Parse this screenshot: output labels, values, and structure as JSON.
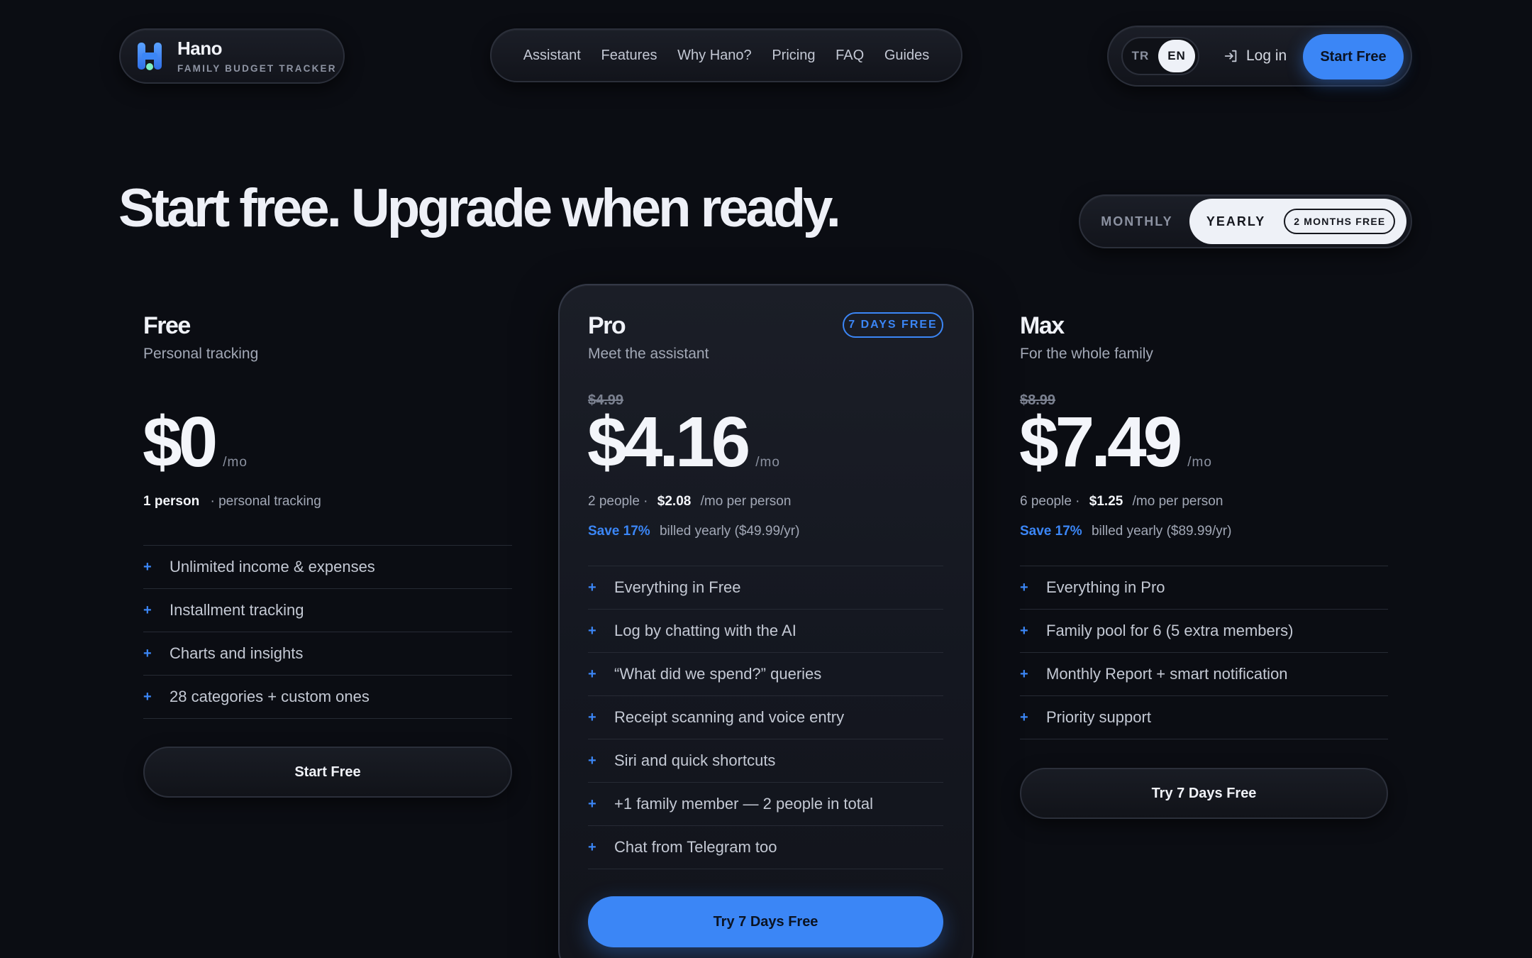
{
  "header": {
    "brand_name": "Hano",
    "brand_tagline": "FAMILY BUDGET TRACKER",
    "nav": [
      "Assistant",
      "Features",
      "Why Hano?",
      "Pricing",
      "FAQ",
      "Guides"
    ],
    "lang_tr": "TR",
    "lang_en": "EN",
    "login_label": "Log in",
    "cta_label": "Start Free"
  },
  "hero": {
    "title": "Start free. Upgrade when ready.",
    "billing": {
      "monthly_label": "MONTHLY",
      "yearly_label": "YEARLY",
      "yearly_badge": "2 MONTHS FREE",
      "selected": "yearly"
    }
  },
  "plans": [
    {
      "name": "Free",
      "subtitle": "Personal tracking",
      "price": "$0",
      "per": "/mo",
      "people_bold": "1 person",
      "people_rest": "· personal tracking",
      "features": [
        "Unlimited income & expenses",
        "Installment tracking",
        "Charts and insights",
        "28 categories + custom ones"
      ],
      "cta": "Start Free"
    },
    {
      "name": "Pro",
      "subtitle": "Meet the assistant",
      "badge": "7 DAYS FREE",
      "old_price": "$4.99",
      "price": "$4.16",
      "per": "/mo",
      "people": "2 people ·",
      "per_person_price": "$2.08",
      "per_person_unit": "/mo per person",
      "save": "Save 17%",
      "billed": "billed yearly ($49.99/yr)",
      "features": [
        "Everything in Free",
        "Log by chatting with the AI",
        "“What did we spend?” queries",
        "Receipt scanning and voice entry",
        "Siri and quick shortcuts",
        "+1 family member — 2 people in total",
        "Chat from Telegram too"
      ],
      "cta": "Try 7 Days Free"
    },
    {
      "name": "Max",
      "subtitle": "For the whole family",
      "old_price": "$8.99",
      "price": "$7.49",
      "per": "/mo",
      "people": "6 people ·",
      "per_person_price": "$1.25",
      "per_person_unit": "/mo per person",
      "save": "Save 17%",
      "billed": "billed yearly ($89.99/yr)",
      "features": [
        "Everything in Pro",
        "Family pool for 6 (5 extra members)",
        "Monthly Report + smart notification",
        "Priority support"
      ],
      "cta": "Try 7 Days Free"
    }
  ],
  "icons": {
    "logo": "hano-logo-icon",
    "login": "login-arrow-icon",
    "feature_bullet": "plus-icon"
  },
  "colors": {
    "background": "#0b0d13",
    "accent": "#3b86f6",
    "text": "#eef0f6",
    "muted": "#a2a8b6"
  }
}
